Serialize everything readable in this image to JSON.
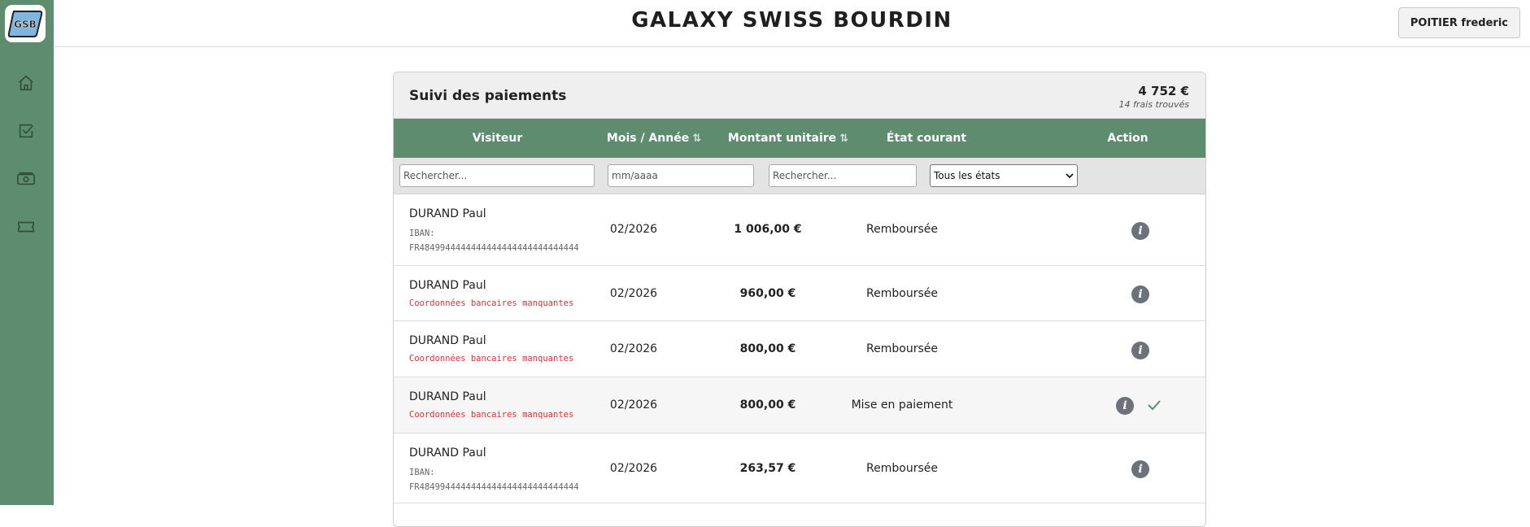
{
  "app": {
    "title": "GALAXY SWISS BOURDIN",
    "logo_text": "GSB",
    "user": "POITIER frederic"
  },
  "sidebar": {
    "items": [
      {
        "name": "home-icon"
      },
      {
        "name": "checklist-icon"
      },
      {
        "name": "cash-icon"
      },
      {
        "name": "ticket-icon"
      }
    ]
  },
  "card": {
    "title": "Suivi des paiements",
    "total": "4 752 €",
    "count": "14 frais trouvés"
  },
  "columns": {
    "visiteur": "Visiteur",
    "mois": "Mois / Année",
    "montant": "Montant unitaire",
    "etat": "État courant",
    "action": "Action"
  },
  "filters": {
    "visiteur_placeholder": "Rechercher...",
    "mois_placeholder": "mm/aaaa",
    "montant_placeholder": "Rechercher...",
    "etat_selected": "Tous les états"
  },
  "rows": [
    {
      "visiteur": "DURAND Paul",
      "iban_label": "IBAN:",
      "iban": "FR4849944444444444444444444444444",
      "mois": "02/2026",
      "montant": "1 006,00 €",
      "etat": "Remboursée"
    },
    {
      "visiteur": "DURAND Paul",
      "missing": "Coordonnées bancaires manquantes",
      "mois": "02/2026",
      "montant": "960,00 €",
      "etat": "Remboursée"
    },
    {
      "visiteur": "DURAND Paul",
      "missing": "Coordonnées bancaires manquantes",
      "mois": "02/2026",
      "montant": "800,00 €",
      "etat": "Remboursée"
    },
    {
      "visiteur": "DURAND Paul",
      "missing": "Coordonnées bancaires manquantes",
      "mois": "02/2026",
      "montant": "800,00 €",
      "etat": "Mise en paiement"
    },
    {
      "visiteur": "DURAND Paul",
      "iban_label": "IBAN:",
      "iban": "FR4849944444444444444444444444444",
      "mois": "02/2026",
      "montant": "263,57 €",
      "etat": "Remboursée"
    }
  ],
  "colors": {
    "accent": "#5e8c6e",
    "missing": "#dd3333",
    "icon": "#6c727a"
  }
}
